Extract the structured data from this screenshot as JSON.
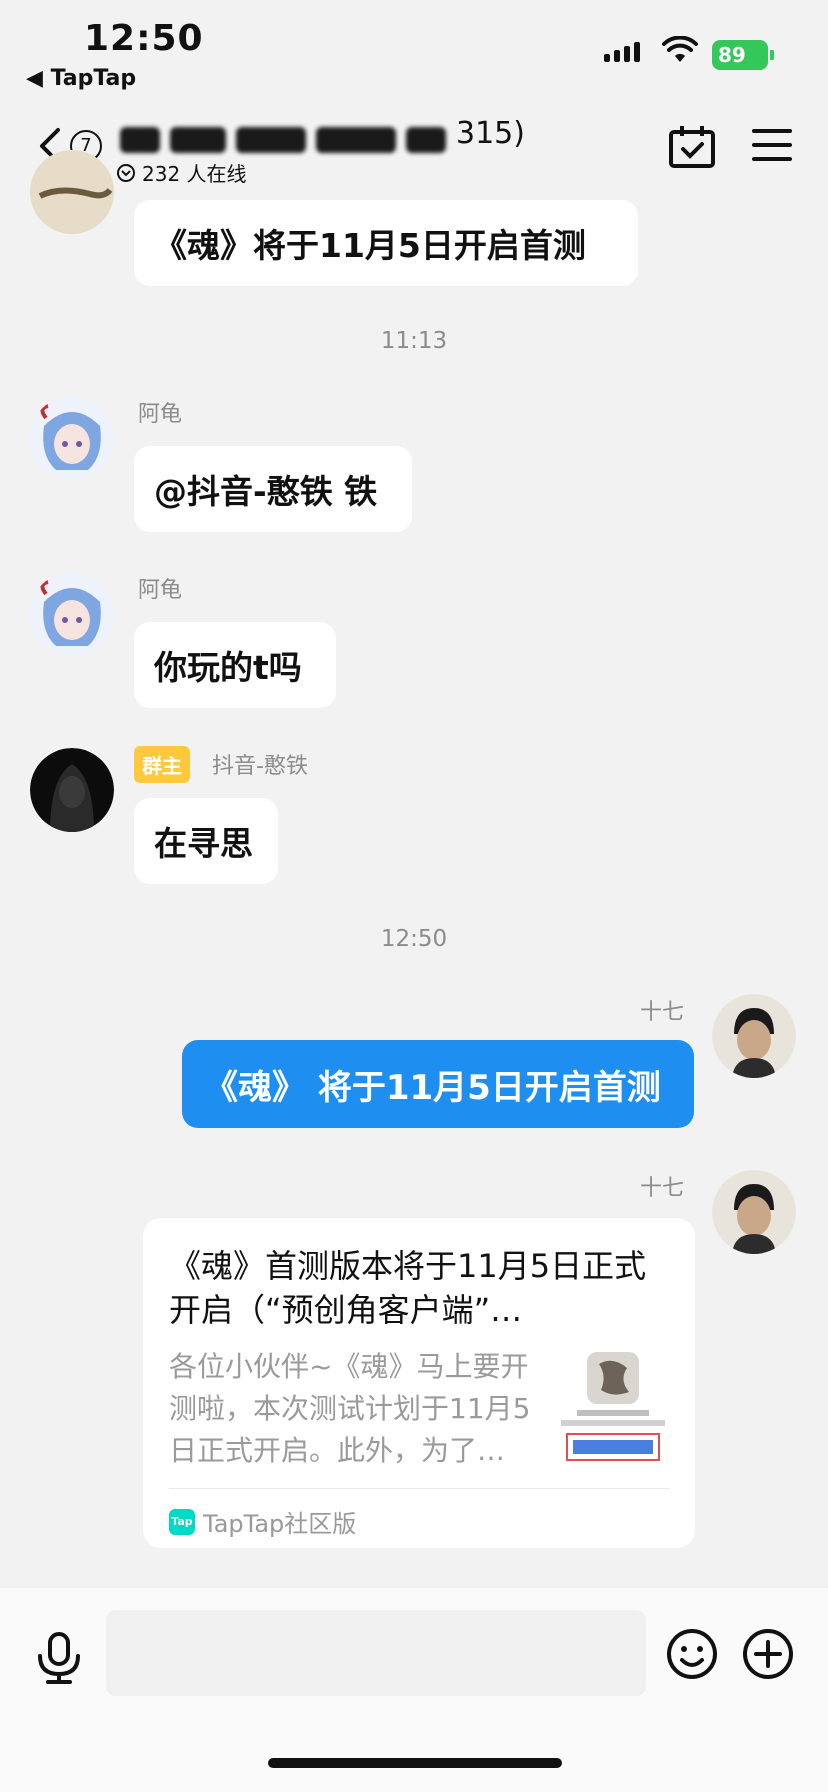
{
  "status_bar": {
    "time": "12:50",
    "back_app": "◀ TapTap",
    "battery": "89"
  },
  "header": {
    "badge_count": "7",
    "title_suffix": "315)",
    "online_text": "232 人在线"
  },
  "messages": [
    {
      "type": "incoming",
      "text": "《魂》将于11月5日开启首测"
    },
    {
      "type": "timestamp",
      "text": "11:13"
    },
    {
      "type": "incoming",
      "name": "阿龟",
      "text": "@抖音-憨铁 铁"
    },
    {
      "type": "incoming",
      "name": "阿龟",
      "text": "你玩的t吗"
    },
    {
      "type": "incoming",
      "role": "群主",
      "name": "抖音-憨铁",
      "text": "在寻思"
    },
    {
      "type": "timestamp",
      "text": "12:50"
    },
    {
      "type": "outgoing",
      "name": "十七",
      "text": "《魂》 将于11月5日开启首测"
    },
    {
      "type": "outgoing_card",
      "name": "十七"
    }
  ],
  "card": {
    "title": "《魂》首测版本将于11月5日正式开启（“预创角客户端”…",
    "description": "各位小伙伴~《魂》马上要开测啦，本次测试计划于11月5日正式开启。此外，为了…",
    "source": "TapTap社区版",
    "logo_text": "Tap"
  },
  "colors": {
    "accent_blue": "#1e8ef0",
    "owner_tag": "#ffc83d",
    "battery": "#34c759"
  }
}
